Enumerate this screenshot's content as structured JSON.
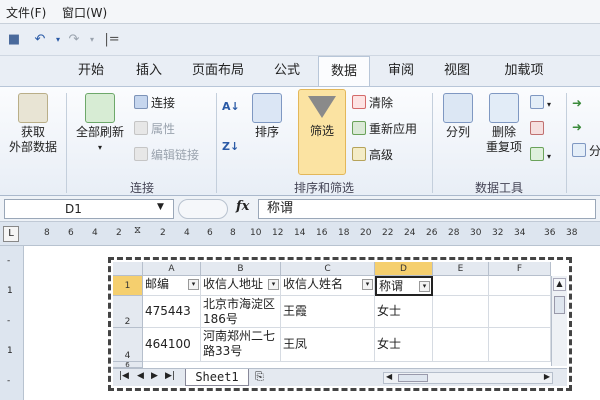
{
  "menu": [
    "文件(F)",
    "窗口(W)"
  ],
  "tabs": [
    "开始",
    "插入",
    "页面布局",
    "公式",
    "数据",
    "审阅",
    "视图",
    "加载项"
  ],
  "ribbon": {
    "get_data": {
      "line1": "获取",
      "line2": "外部数据"
    },
    "refresh_all": "全部刷新",
    "connections": "连接",
    "properties": "属性",
    "edit_links": "编辑链接",
    "group_connections": "连接",
    "sort": "排序",
    "filter": "筛选",
    "clear": "清除",
    "reapply": "重新应用",
    "advanced": "高级",
    "group_sort_filter": "排序和筛选",
    "split_columns": "分列",
    "remove_dup": {
      "line1": "删除",
      "line2": "重复项"
    },
    "group_data_tools": "数据工具",
    "partial_right": "分"
  },
  "formula_bar": {
    "name_box": "D1",
    "fx": "fx",
    "value": "称谓"
  },
  "ruler_h": [
    "8",
    "6",
    "4",
    "2",
    "2",
    "4",
    "6",
    "8",
    "10",
    "12",
    "14",
    "16",
    "18",
    "20",
    "22",
    "24",
    "26",
    "28",
    "30",
    "32",
    "34",
    "36",
    "38"
  ],
  "ruler_v": [
    "-",
    "1",
    "-",
    "1",
    "-"
  ],
  "sheet": {
    "columns": [
      "A",
      "B",
      "C",
      "D",
      "E",
      "F"
    ],
    "rows": [
      "1",
      "2",
      "4",
      "6"
    ],
    "headers": [
      "邮编",
      "收信人地址",
      "收信人姓名",
      "称谓"
    ],
    "data": [
      [
        "475443",
        "北京市海淀区186号",
        "王霞",
        "女士"
      ],
      [
        "464100",
        "河南郑州二七路33号",
        "王凤",
        "女士"
      ]
    ],
    "tab": "Sheet1"
  }
}
